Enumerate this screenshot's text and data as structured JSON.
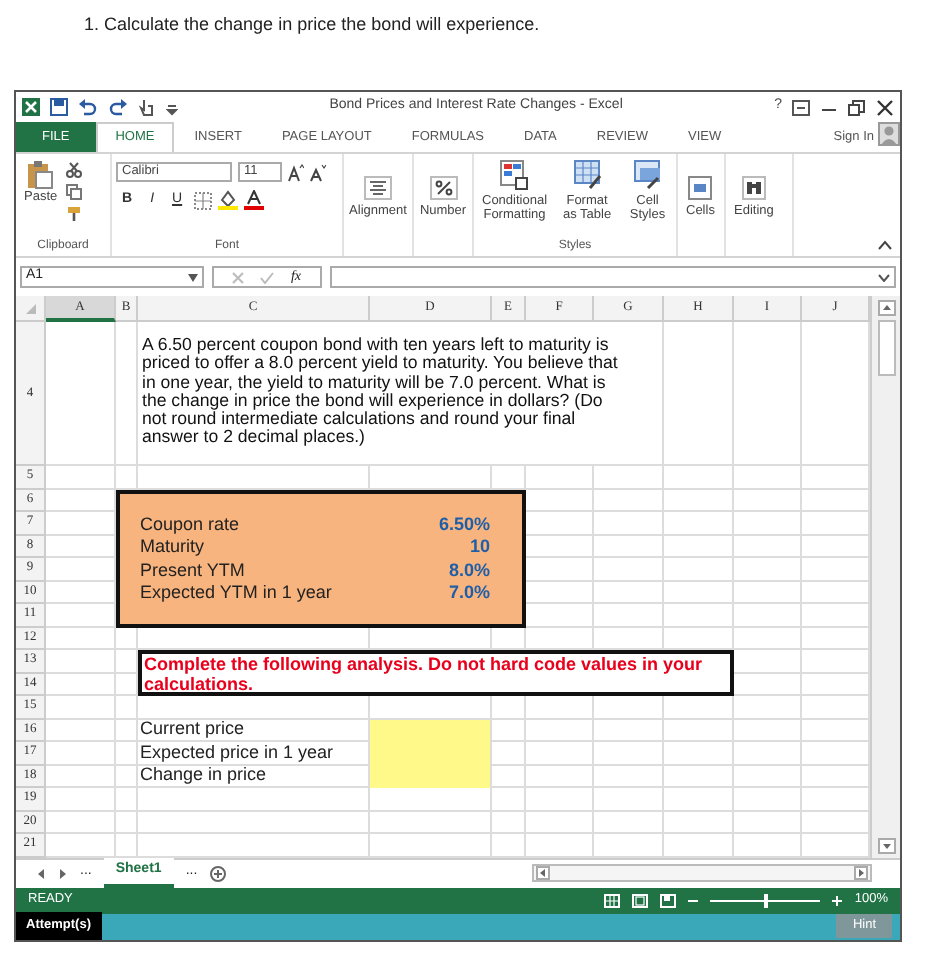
{
  "question": "1. Calculate the change in price the bond will experience.",
  "window": {
    "title": "Bond Prices and Interest Rate Changes - Excel",
    "help": "?"
  },
  "ribbon_tabs": [
    {
      "label": "FILE",
      "kind": "file",
      "selected": false
    },
    {
      "label": "HOME",
      "kind": "tab",
      "selected": true
    },
    {
      "label": "INSERT",
      "kind": "tab",
      "selected": false
    },
    {
      "label": "PAGE LAYOUT",
      "kind": "tab",
      "selected": false
    },
    {
      "label": "FORMULAS",
      "kind": "tab",
      "selected": false
    },
    {
      "label": "DATA",
      "kind": "tab",
      "selected": false
    },
    {
      "label": "REVIEW",
      "kind": "tab",
      "selected": false
    },
    {
      "label": "VIEW",
      "kind": "tab",
      "selected": false
    }
  ],
  "sign_in": "Sign In",
  "ribbon": {
    "paste": "Paste",
    "font_name": "Calibri",
    "font_size": "11",
    "bold": "B",
    "italic": "I",
    "underline": "U",
    "big_buttons": [
      {
        "label": "Alignment",
        "kind": "alignment"
      },
      {
        "label": "Number",
        "kind": "number"
      }
    ],
    "styles_buttons": [
      {
        "label": "Conditional Formatting",
        "kind": "conditional"
      },
      {
        "label": "Format as Table",
        "kind": "table"
      },
      {
        "label": "Cell Styles",
        "kind": "styles"
      }
    ],
    "end_buttons": [
      {
        "label": "Cells",
        "kind": "cells"
      },
      {
        "label": "Editing",
        "kind": "editing"
      }
    ],
    "group_labels": [
      "Clipboard",
      "Font",
      "Styles"
    ]
  },
  "formula_bar": {
    "name_box": "A1",
    "fx": "fx"
  },
  "sheet": {
    "columns": [
      {
        "label": "A",
        "selected": true
      },
      {
        "label": "B",
        "selected": false
      },
      {
        "label": "C",
        "selected": false
      },
      {
        "label": "D",
        "selected": false
      },
      {
        "label": "E",
        "selected": false
      },
      {
        "label": "F",
        "selected": false
      },
      {
        "label": "G",
        "selected": false
      },
      {
        "label": "H",
        "selected": false
      },
      {
        "label": "I",
        "selected": false
      },
      {
        "label": "J",
        "selected": false
      }
    ],
    "rows": [
      "4",
      "5",
      "6",
      "7",
      "8",
      "9",
      "10",
      "11",
      "12",
      "13",
      "14",
      "15",
      "16",
      "17",
      "18",
      "19",
      "20",
      "21"
    ],
    "problem": "A 6.50 percent coupon bond with ten years left to maturity is priced to offer a 8.0 percent yield to maturity. You believe that in one year, the yield to maturity will be 7.0 percent. What is the change in price the bond will experience in dollars? (Do not round intermediate calculations and round your final answer to 2 decimal places.)",
    "inputs": [
      {
        "label": "Coupon rate",
        "value": "6.50%"
      },
      {
        "label": "Maturity",
        "value": "10"
      },
      {
        "label": "Present YTM",
        "value": "8.0%"
      },
      {
        "label": "Expected YTM in 1 year",
        "value": "7.0%"
      }
    ],
    "instruction": "Complete the following analysis. Do not hard code values in your calculations.",
    "outputs": [
      {
        "label": "Current price"
      },
      {
        "label": "Expected price in 1 year"
      },
      {
        "label": "Change in price"
      }
    ]
  },
  "sheet_tabs": {
    "more_left": "...",
    "tabs": [
      {
        "label": "Sheet1",
        "selected": true
      }
    ],
    "more_right": "..."
  },
  "status_bar": {
    "status": "READY",
    "zoom": "100%",
    "zoom_slider": {
      "level": 0.5
    }
  },
  "attempt_bar": {
    "attempts": "Attempt(s)",
    "hint": "Hint"
  }
}
